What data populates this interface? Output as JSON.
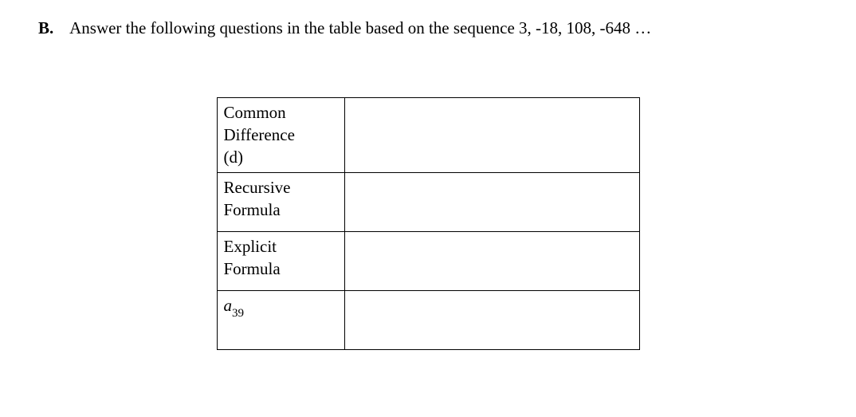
{
  "question": {
    "label": "B.",
    "text": "Answer the following questions in the table based on the sequence 3, -18, 108, -648 …"
  },
  "table": {
    "rows": [
      {
        "label_lines": [
          "Common",
          "Difference",
          "(d)"
        ],
        "answer": ""
      },
      {
        "label_lines": [
          "Recursive",
          "Formula"
        ],
        "answer": ""
      },
      {
        "label_lines": [
          "Explicit",
          "Formula"
        ],
        "answer": ""
      }
    ],
    "math_row": {
      "variable": "a",
      "subscript": "39",
      "answer": ""
    }
  }
}
